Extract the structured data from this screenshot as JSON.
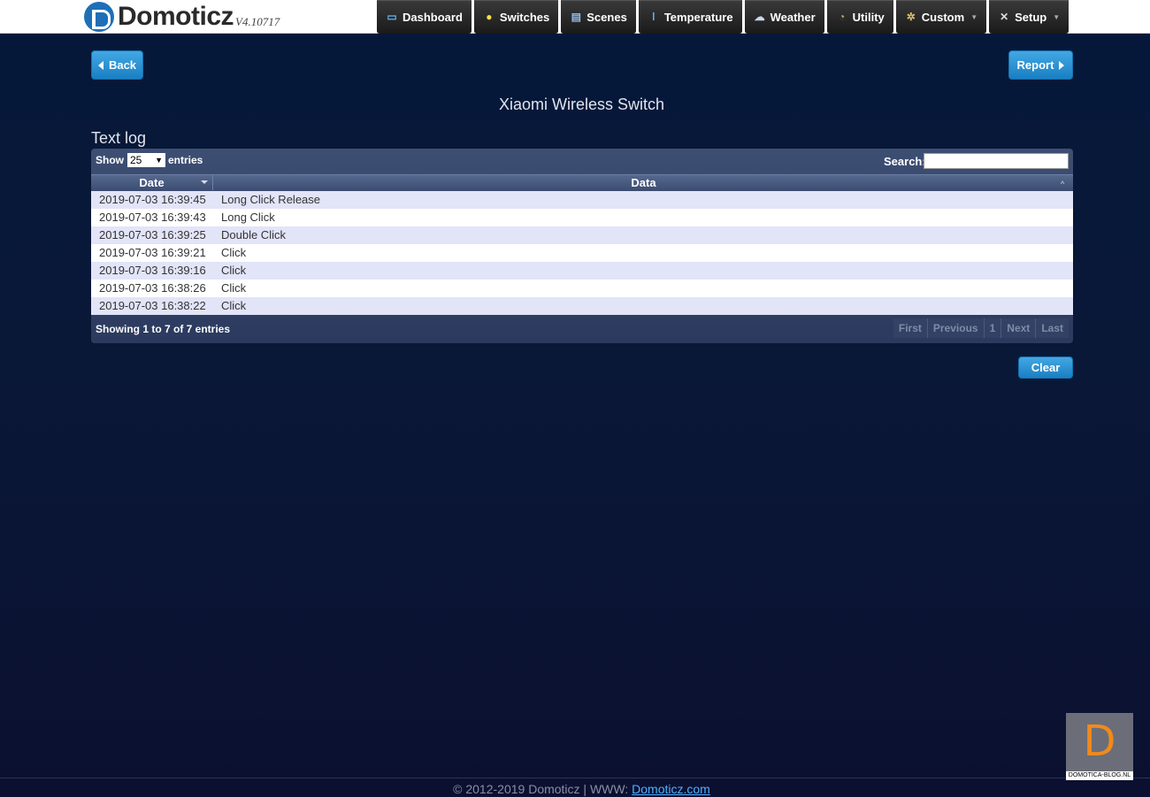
{
  "header": {
    "logo_name": "Domoticz",
    "logo_version": "V4.10717",
    "nav": [
      {
        "label": "Dashboard",
        "icon": "dashboard-icon"
      },
      {
        "label": "Switches",
        "icon": "lightbulb-icon"
      },
      {
        "label": "Scenes",
        "icon": "scenes-icon"
      },
      {
        "label": "Temperature",
        "icon": "thermometer-icon"
      },
      {
        "label": "Weather",
        "icon": "cloud-rain-icon"
      },
      {
        "label": "Utility",
        "icon": "utility-icon"
      },
      {
        "label": "Custom",
        "icon": "gear-icon"
      },
      {
        "label": "Setup",
        "icon": "tools-icon"
      }
    ]
  },
  "toolbar": {
    "back_label": "Back",
    "report_label": "Report",
    "clear_label": "Clear"
  },
  "page": {
    "device_title": "Xiaomi Wireless Switch",
    "section_title": "Text log"
  },
  "table": {
    "show_label": "Show",
    "page_size": "25",
    "entries_label": "entries",
    "search_label": "Search:",
    "search_value": "",
    "columns": [
      "Date",
      "Data"
    ],
    "rows": [
      {
        "date": "2019-07-03 16:39:45",
        "data": "Long Click Release"
      },
      {
        "date": "2019-07-03 16:39:43",
        "data": "Long Click"
      },
      {
        "date": "2019-07-03 16:39:25",
        "data": "Double Click"
      },
      {
        "date": "2019-07-03 16:39:21",
        "data": "Click"
      },
      {
        "date": "2019-07-03 16:39:16",
        "data": "Click"
      },
      {
        "date": "2019-07-03 16:38:26",
        "data": "Click"
      },
      {
        "date": "2019-07-03 16:38:22",
        "data": "Click"
      }
    ],
    "info": "Showing 1 to 7 of 7 entries",
    "pager": [
      "First",
      "Previous",
      "1",
      "Next",
      "Last"
    ]
  },
  "footer": {
    "text": "© 2012-2019 Domoticz | WWW:",
    "link": "Domoticz.com"
  },
  "watermark": {
    "letter": "D",
    "text": "DOMOTICA-BLOG.NL"
  },
  "colors": {
    "accent": "#1a7fc2",
    "background": "#0a1838",
    "watermark_letter": "#f08a1c"
  }
}
